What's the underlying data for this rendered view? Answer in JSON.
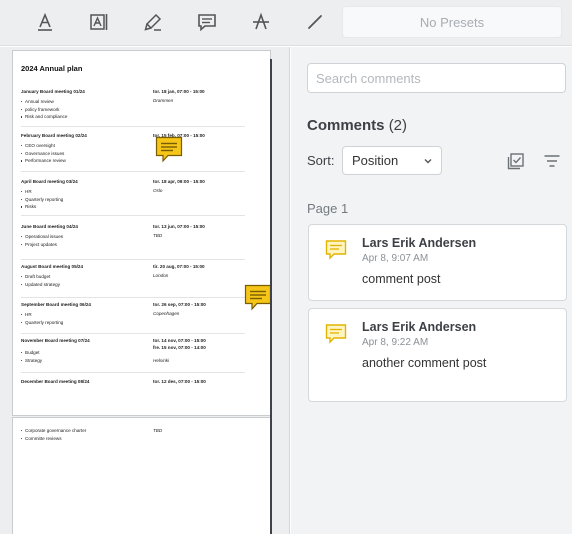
{
  "toolbar": {
    "tools": [
      {
        "name": "text-color-tool"
      },
      {
        "name": "free-text-tool"
      },
      {
        "name": "highlighter-tool"
      },
      {
        "name": "comment-tool"
      },
      {
        "name": "strikeout-tool"
      },
      {
        "name": "line-tool"
      }
    ],
    "presets_label": "No Presets"
  },
  "document": {
    "title": "2024 Annual plan",
    "meetings": [
      {
        "name": "January Board meeting 01/24",
        "date": "tor. 18 jan, 07:00 - 15:00",
        "location": "Drammen",
        "items": [
          "Annual review",
          "policy framework",
          "Risk and compliance"
        ]
      },
      {
        "name": "February Board meeting 02/24",
        "date": "tor. 15 feb, 07:00 - 15:00",
        "location": "",
        "items": [
          "CEO oversight",
          "Governance issues",
          "Performance review"
        ]
      },
      {
        "name": "April Board meeting 03/24",
        "date": "tor. 18 apr, 09:00 - 15:00",
        "location": "Oslo",
        "items": [
          "HR",
          "Quarterly reporting",
          "Risks"
        ]
      },
      {
        "name": "June Board meeting 04/24",
        "date": "tor. 13 jun, 07:00 - 15:00",
        "location": "TBD",
        "items": [
          "Operational issues",
          "Project updates"
        ]
      },
      {
        "name": "August Board meeting 05/24",
        "date": "tir. 20 aug, 07:00 - 15:00",
        "location": "London",
        "items": [
          "Draft budget",
          "Updated strategy"
        ]
      },
      {
        "name": "September Board meeting 06/24",
        "date": "tor. 26 sep, 07:00 - 15:00",
        "location": "Copenhagen",
        "items": [
          "HR",
          "Quarterly reporting"
        ]
      },
      {
        "name": "November Board meeting 07/24",
        "date": "tor. 14 nov, 07:00 - 15:00\nfre. 15 nov, 07:00 - 14:00",
        "location": "Helsinki",
        "items": [
          "Budget",
          "Strategy"
        ]
      },
      {
        "name": "December Board meeting 08/24",
        "date": "tor. 12 des, 07:00 - 15:00",
        "location": "",
        "items": []
      }
    ],
    "page2": {
      "items": [
        "Corporate governance charter",
        "Committe reviews"
      ],
      "location": "TBD"
    }
  },
  "comments": {
    "search_placeholder": "Search comments",
    "title": "Comments",
    "count": "(2)",
    "sort_label": "Sort:",
    "sort_value": "Position",
    "page_label": "Page 1",
    "accent_color": "#f5c518",
    "items": [
      {
        "author": "Lars Erik Andersen",
        "time": "Apr 8, 9:07 AM",
        "text": "comment post"
      },
      {
        "author": "Lars Erik Andersen",
        "time": "Apr 8, 9:22 AM",
        "text": "another comment post"
      }
    ]
  }
}
